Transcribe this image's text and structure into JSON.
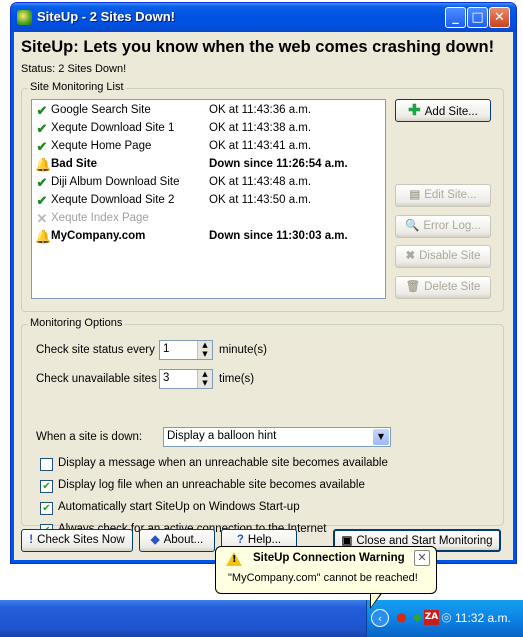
{
  "window": {
    "title": "SiteUp - 2 Sites Down!",
    "headline": "SiteUp: Lets you know when the web comes crashing down!",
    "status": "Status: 2 Sites Down!"
  },
  "list_group": {
    "label": "Site Monitoring List",
    "rows": [
      {
        "name": "Google Search Site",
        "status": "OK at 11:43:36 a.m.",
        "icon": "check-icon"
      },
      {
        "name": "Xequte Download Site 1",
        "status": "OK at 11:43:38 a.m.",
        "icon": "check-icon"
      },
      {
        "name": "Xequte Home Page",
        "status": "OK at 11:43:41 a.m.",
        "icon": "check-icon"
      },
      {
        "name": "Bad Site",
        "status": "Down since 11:26:54 a.m.",
        "icon": "alarm-bell-icon"
      },
      {
        "name": "Diji Album Download Site",
        "status": "OK at 11:43:48 a.m.",
        "icon": "check-icon"
      },
      {
        "name": "Xequte Download Site 2",
        "status": "OK at 11:43:50 a.m.",
        "icon": "check-icon"
      },
      {
        "name": "Xequte Index Page",
        "status": "",
        "icon": "disabled-x-icon"
      },
      {
        "name": "MyCompany.com",
        "status": "Down since 11:30:03 a.m.",
        "icon": "alarm-bell-icon"
      }
    ],
    "buttons": {
      "add": "Add Site...",
      "edit": "Edit Site...",
      "errorlog": "Error Log...",
      "disable": "Disable Site",
      "delete": "Delete Site"
    }
  },
  "options": {
    "label": "Monitoring Options",
    "check_every_label": "Check site status every",
    "check_every_value": "1",
    "check_every_unit": "minute(s)",
    "unavailable_label": "Check unavailable sites",
    "unavailable_value": "3",
    "unavailable_unit": "time(s)",
    "down_label": "When a site is down:",
    "down_value": "Display a balloon hint",
    "checkboxes": [
      {
        "label": "Display a message when an unreachable site becomes available",
        "checked": false
      },
      {
        "label": "Display log file when an unreachable site becomes available",
        "checked": true
      },
      {
        "label": "Automatically start SiteUp on Windows Start-up",
        "checked": true
      },
      {
        "label": "Always check for an active connection to the Internet",
        "checked": true
      }
    ]
  },
  "bottom": {
    "check_now": "Check Sites Now",
    "about": "About...",
    "help": "Help...",
    "close_start": "Close and Start Monitoring"
  },
  "balloon": {
    "title": "SiteUp Connection Warning",
    "message": "\"MyCompany.com\" cannot be reached!"
  },
  "taskbar": {
    "clock": "11:32 a.m."
  },
  "colors": {
    "titlebar": "#0054e3",
    "ok": "#1f8a23",
    "alert": "#d42a10",
    "balloon": "#ffffe1"
  }
}
